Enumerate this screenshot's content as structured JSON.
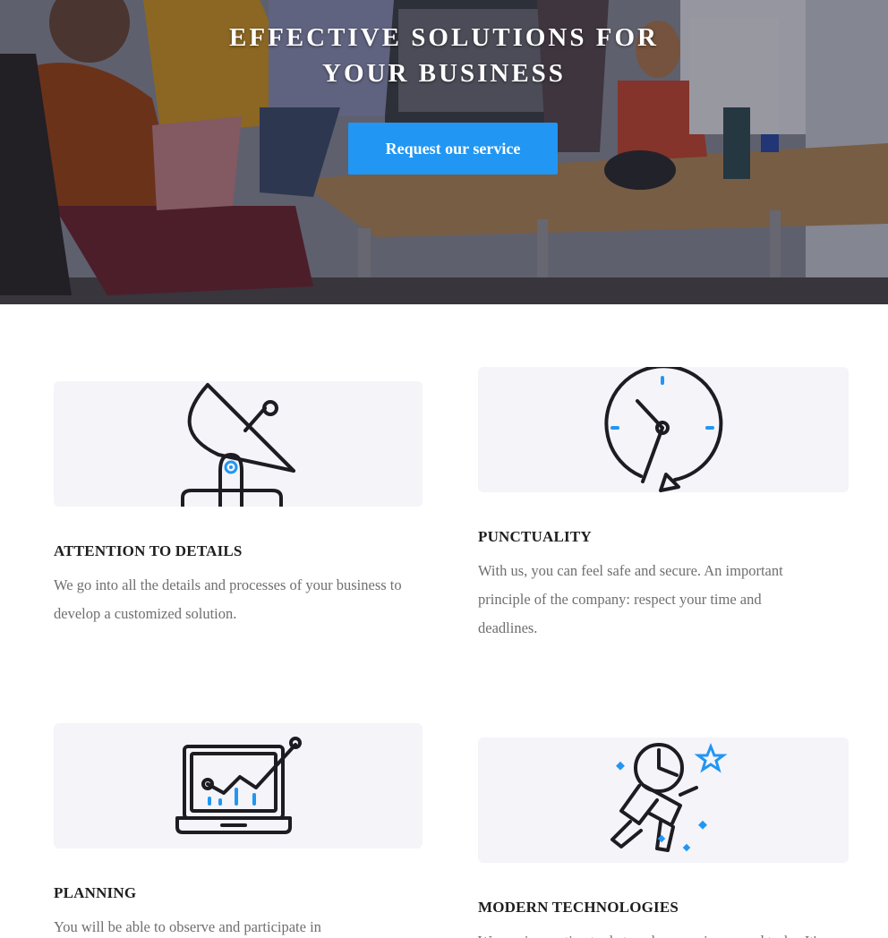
{
  "hero": {
    "title_line1": "EFFECTIVE SOLUTIONS FOR",
    "title_line2": "YOUR BUSINESS",
    "cta_label": "Request our service"
  },
  "features": [
    {
      "icon": "satellite-dish-icon",
      "title": "ATTENTION TO DETAILS",
      "text": "We go into all the details and processes of your business to develop a customized solution."
    },
    {
      "icon": "clock-icon",
      "title": "PUNCTUALITY",
      "text": "With us, you can feel safe and secure. An important principle of the company: respect your time and deadlines."
    },
    {
      "icon": "laptop-chart-icon",
      "title": "PLANNING",
      "text": "You will be able to observe and participate in"
    },
    {
      "icon": "astronaut-icon",
      "title": "MODERN TECHNOLOGIES",
      "text": "We use innovative tools to solve your issues and tasks. It's"
    }
  ],
  "colors": {
    "accent": "#2196f3",
    "card_bg": "#f4f4f9",
    "icon_stroke": "#1c1c22",
    "text_muted": "#6f6f6f"
  }
}
